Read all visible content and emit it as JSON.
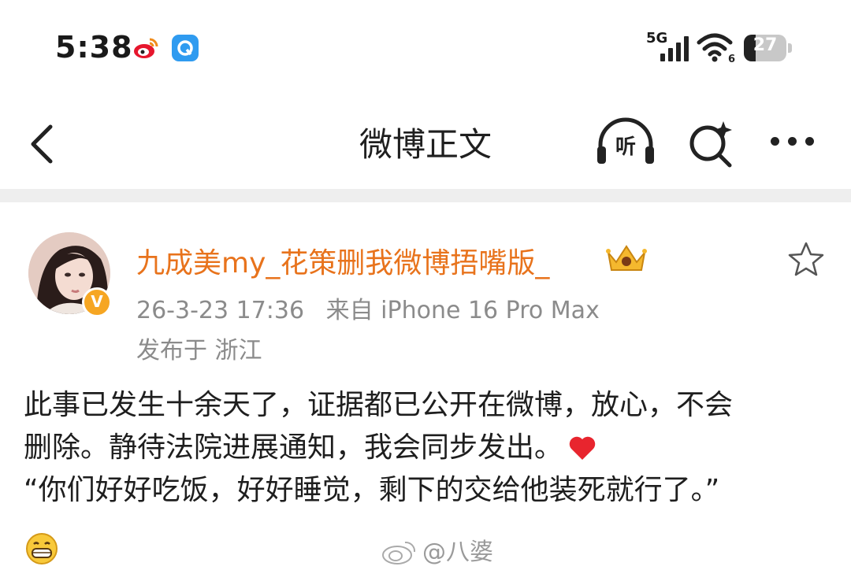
{
  "status_bar": {
    "time": "5:38",
    "network": "5G",
    "wifi_badge": "6",
    "battery_level": "27",
    "battery_fraction": 0.27
  },
  "nav": {
    "title": "微博正文",
    "listen_label": "听",
    "icons": [
      "back-arrow-icon",
      "headphones-icon",
      "search-sparkle-icon",
      "more-dots-icon"
    ]
  },
  "post": {
    "author": "九成美my_花策删我微博捂嘴版_",
    "date": "26-3-23 17:36",
    "source": "来自 iPhone 16 Pro Max",
    "location": "发布于 浙江",
    "verified_mark": "V",
    "lines": [
      "此事已发生十余天了，证据都已公开在微博，放心，不会",
      "删除。静待法院进展通知，我会同步发出。",
      "“你们好好吃饭，好好睡觉，剩下的交给他装死就行了。”"
    ]
  },
  "watermark": "@八婆",
  "colors": {
    "username": "#e8731c",
    "meta": "#8b8b8b",
    "divider": "#eeeeee",
    "badge": "#f6a623",
    "heart": "#e8252e"
  }
}
